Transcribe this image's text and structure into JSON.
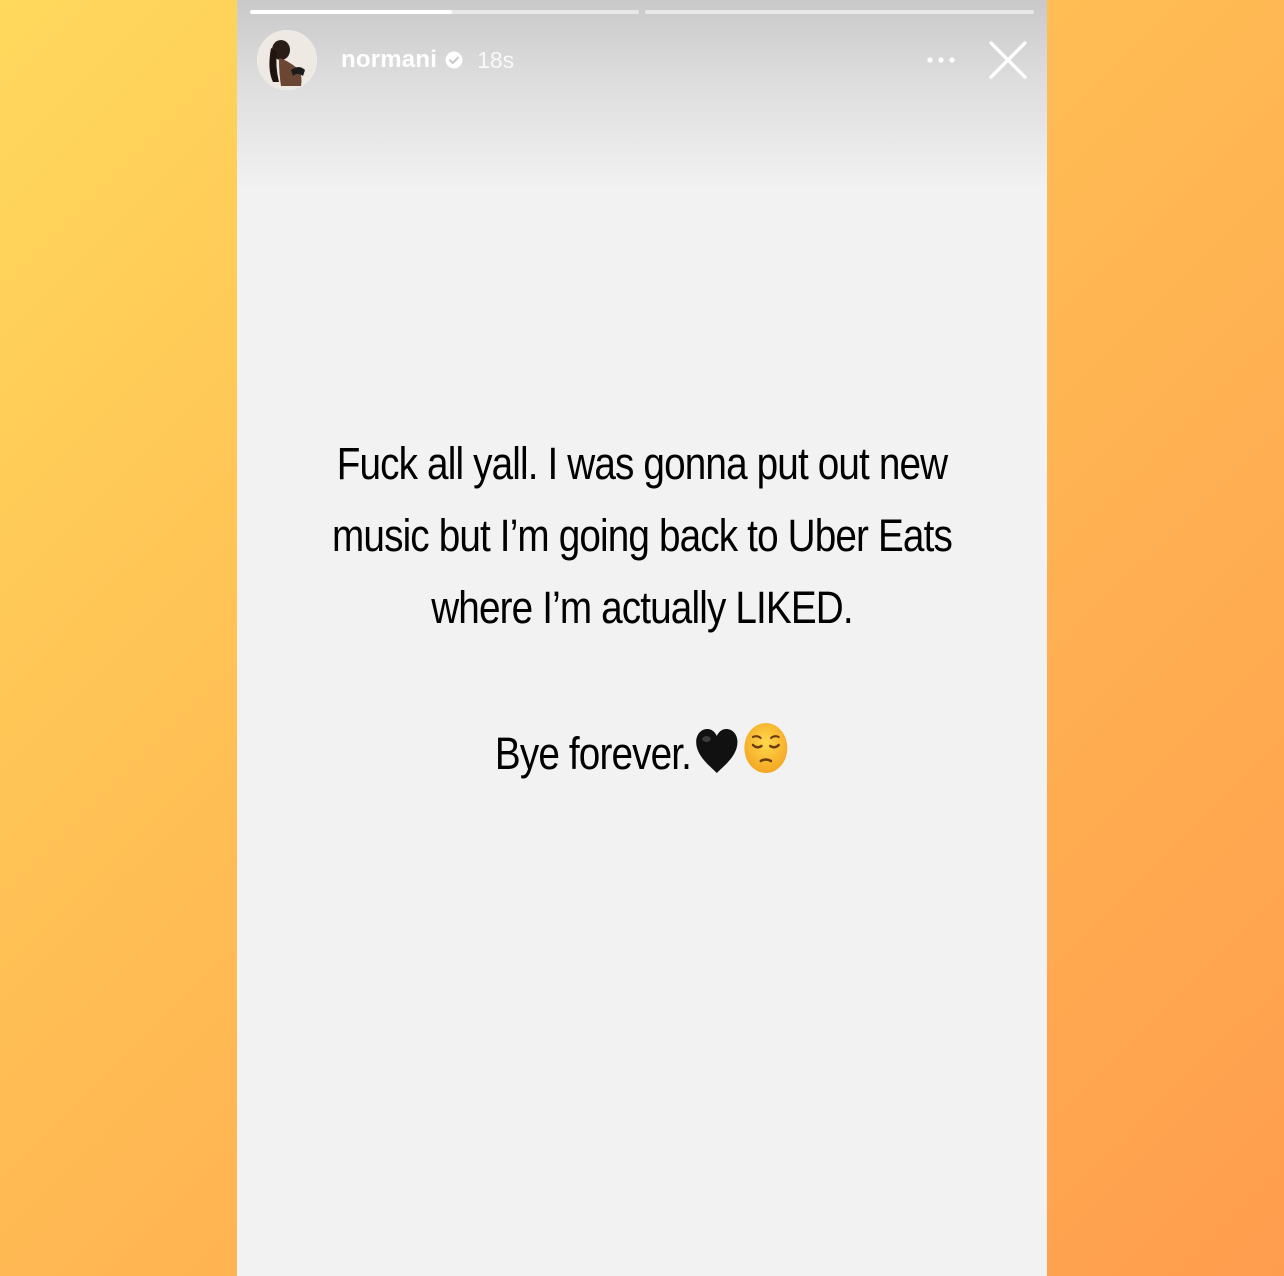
{
  "story": {
    "username": "normani",
    "verified": true,
    "timestamp": "18s",
    "progress": [
      {
        "segment": 1,
        "fraction": 0.52
      },
      {
        "segment": 2,
        "fraction": 0.0
      }
    ],
    "text_lines": [
      "Fuck all yall. I was gonna put out new",
      "music but I’m going back to Uber Eats",
      "where I’m actually LIKED."
    ],
    "closing_line": "Bye forever.",
    "emojis": [
      "black-heart",
      "pensive-face"
    ]
  },
  "icons": {
    "more": "more-horizontal-icon",
    "close": "close-icon",
    "verified": "verified-badge-icon"
  },
  "colors": {
    "background_gradient_start": "#ffd95c",
    "background_gradient_end": "#ff9d4e",
    "story_background": "#f2f2f2",
    "text": "#000000"
  }
}
